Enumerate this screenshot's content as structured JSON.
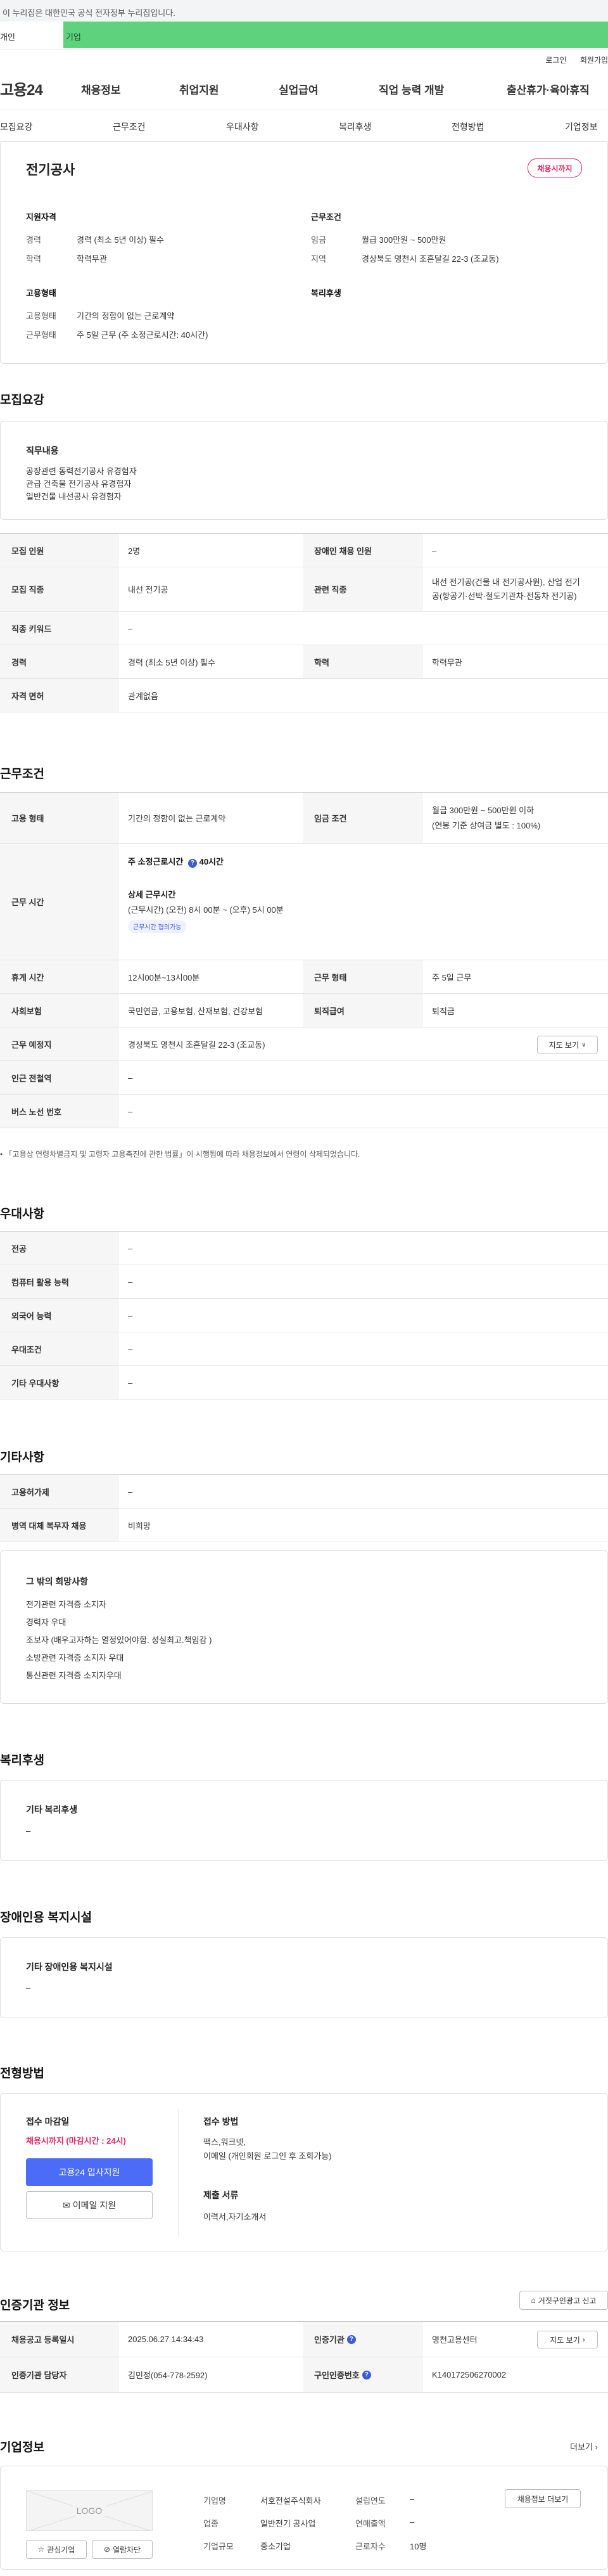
{
  "banner": {
    "text": "이 누리집은 대한민국 공식 전자정부 누리집입니다."
  },
  "topbar": {
    "personal": "개인",
    "business": "기업"
  },
  "util": {
    "login": "로그인",
    "join": "회원가입"
  },
  "gnb": {
    "logo": "고용24",
    "menu": [
      "채용정보",
      "취업지원",
      "실업급여",
      "직업 능력 개발",
      "출산휴가·육아휴직"
    ]
  },
  "tabs": [
    "모집요강",
    "근무조건",
    "우대사항",
    "복리후생",
    "전형방법",
    "기업정보"
  ],
  "summary": {
    "company": "전기공사",
    "status": "채용시까지",
    "qual_title": "지원자격",
    "career_label": "경력",
    "career_value": "경력 (최소 5년 이상) 필수",
    "edu_label": "학력",
    "edu_value": "학력무관",
    "cond_title": "근무조건",
    "wage_label": "임금",
    "wage_value": "월급 300만원 ~ 500만원",
    "area_label": "지역",
    "area_value": "경상북도 영천시 조흔달길 22-3 (조교동)",
    "emp_title": "고용형태",
    "emp_label": "고용형태",
    "emp_value": "기간의 정함이 없는 근로계약",
    "worktype_label": "근무형태",
    "worktype_value": "주 5일 근무 (주 소정근로시간: 40시간)",
    "welfare_title": "복리후생"
  },
  "recruit": {
    "title": "모집요강",
    "duty_title": "직무내용",
    "duty_lines": [
      "공장관련  동력전기공사 유경험자",
      "관급 건축물 전기공사   유경험자",
      "일반건물  내선공사  유경험자"
    ],
    "rows": [
      {
        "th1": "모집 인원",
        "td1": "2명",
        "th2": "장애인 채용 인원",
        "td2": "–"
      },
      {
        "th1": "모집 직종",
        "td1": "내선 전기공",
        "th2": "관련 직종",
        "td2a": "내선 전기공(건물 내 전기공사원), 산업 전기",
        "td2b": "공(항공기·선박·철도기관차·전동차 전기공)"
      },
      {
        "th1": "직종 키워드",
        "td1": "–"
      },
      {
        "th1": "경력",
        "td1": "경력 (최소 5년 이상) 필수",
        "th2": "학력",
        "td2": "학력무관"
      },
      {
        "th1": "자격 면허",
        "td1": "관계없음"
      }
    ]
  },
  "work": {
    "title": "근무조건",
    "emp_th": "고용 형태",
    "emp_td": "기간의 정함이 없는 근로계약",
    "wage_th": "임금 조건",
    "wage_td1": "월급 300만원 ~ 500만원 이하",
    "wage_td2": "(연봉 기준 상여금 별도 : 100%)",
    "time_th": "근무 시간",
    "time_main": "주 소정근로시간",
    "time_hours": "40시간",
    "time_detail_title": "상세 근무시간",
    "time_detail": "(근무시간) (오전) 8시 00분 ~ (오후) 5시 00분",
    "time_tag": "근무시간 협의가능",
    "rest_th": "휴게 시간",
    "rest_td": "12시00분~13시00분",
    "form_th": "근무 형태",
    "form_td": "주 5일 근무",
    "ins_th": "사회보험",
    "ins_td": "국민연금, 고용보험, 산재보험, 건강보험",
    "retire_th": "퇴직급여",
    "retire_td": "퇴직금",
    "place_th": "근무 예정지",
    "place_td": "경상북도 영천시 조흔달길 22-3 (조교동)",
    "map_btn": "지도 보기",
    "station_th": "인근 전철역",
    "station_td": "–",
    "bus_th": "버스 노선 번호",
    "bus_td": "–",
    "note": "「고용상 연령차별금지 및 고령자 고용촉진에 관한 법률」이 시행됨에 따라 채용정보에서 연령이 삭제되었습니다."
  },
  "pref": {
    "title": "우대사항",
    "rows": [
      {
        "th": "전공",
        "td": "–"
      },
      {
        "th": "컴퓨터 활용 능력",
        "td": "–"
      },
      {
        "th": "외국어 능력",
        "td": "–"
      },
      {
        "th": "우대조건",
        "td": "–"
      },
      {
        "th": "기타 우대사항",
        "td": "–"
      }
    ]
  },
  "etc": {
    "title": "기타사항",
    "rows": [
      {
        "th": "고용허가제",
        "td": "–"
      },
      {
        "th": "병역 대체 복무자 채용",
        "td": "비희망"
      }
    ],
    "hope_title": "그 밖의 희망사항",
    "hope_lines": [
      "전기관련 자격증 소지자",
      "경력자 우대",
      "조보자   (배우고자하는 열정있어야함.  성실최고.책임감 )",
      "소방관련 자격증 소지자 우대",
      "통신관련 자격증 소지자우대"
    ]
  },
  "benefit": {
    "title": "복리후생",
    "sub": "기타 복리후생",
    "value": "–"
  },
  "disab": {
    "title": "장애인용 복지시설",
    "sub": "기타 장애인용 복지시설",
    "value": "–"
  },
  "screen": {
    "title": "전형방법",
    "deadline_title": "접수 마감일",
    "deadline": "채용시까지 (마감시간 : 24시)",
    "apply_btn": "고용24 입사지원",
    "email_btn": "이메일 지원",
    "method_title": "접수 방법",
    "method_lines": [
      "팩스,워크넷,",
      "이메일 (개인회원 로그인 후 조회가능)"
    ],
    "docs_title": "제출 서류",
    "docs": "이력서,자기소개서"
  },
  "cert": {
    "title": "인증기관 정보",
    "report_btn": "거짓구인광고 신고",
    "r1": {
      "th1": "채용공고 등록일시",
      "td1": "2025.06.27 14:34:43",
      "th2": "인증기관",
      "td2": "영천고용센터",
      "map_btn": "지도 보기"
    },
    "r2": {
      "th1": "인증기관 담당자",
      "td1": "김민정(054-778-2592)",
      "th2": "구인인증번호",
      "td2": "K140172506270002"
    }
  },
  "company": {
    "title": "기업정보",
    "more": "더보기",
    "logo": "LOGO",
    "fav_btn": "관심기업",
    "block_btn": "열람차단",
    "name_label": "기업명",
    "name": "서호전설주식회사",
    "year_label": "설립연도",
    "year": "–",
    "job_btn": "채용정보 더보기",
    "industry_label": "업종",
    "industry": "일반전기 공사업",
    "sales_label": "연매출액",
    "sales": "–",
    "size_label": "기업규모",
    "size": "중소기업",
    "staff_label": "근로자수",
    "staff": "10명"
  }
}
